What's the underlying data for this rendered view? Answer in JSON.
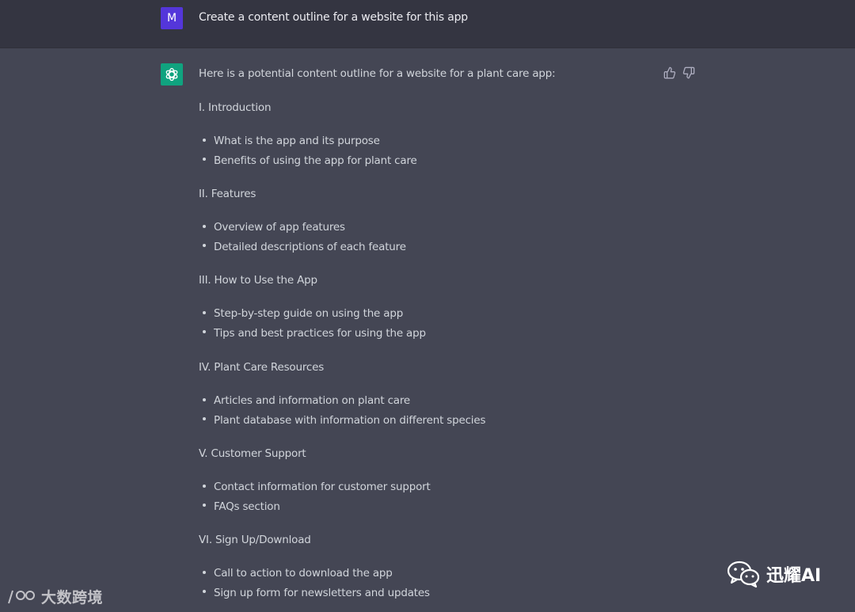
{
  "user_prompt": {
    "avatar_letter": "M",
    "text": "Create a content outline for a website for this app",
    "avatar_color": "#5436da"
  },
  "response": {
    "intro": "Here is a potential content outline for a website for a plant care app:",
    "sections": [
      {
        "heading": "I. Introduction",
        "bullets": [
          "What is the app and its purpose",
          "Benefits of using the app for plant care"
        ]
      },
      {
        "heading": "II. Features",
        "bullets": [
          "Overview of app features",
          "Detailed descriptions of each feature"
        ]
      },
      {
        "heading": "III. How to Use the App",
        "bullets": [
          "Step-by-step guide on using the app",
          "Tips and best practices for using the app"
        ]
      },
      {
        "heading": "IV. Plant Care Resources",
        "bullets": [
          "Articles and information on plant care",
          "Plant database with information on different species"
        ]
      },
      {
        "heading": "V. Customer Support",
        "bullets": [
          "Contact information for customer support",
          "FAQs section"
        ]
      },
      {
        "heading": "VI. Sign Up/Download",
        "bullets": [
          "Call to action to download the app",
          "Sign up form for newsletters and updates"
        ]
      }
    ],
    "assistant_avatar_icon": "openai-logo-icon",
    "assistant_avatar_color": "#10a37f"
  },
  "feedback": {
    "thumbs_up_icon": "thumbs-up-icon",
    "thumbs_down_icon": "thumbs-down-icon"
  },
  "watermarks": {
    "left": "大数跨境",
    "right": "迅耀AI"
  },
  "colors": {
    "user_row_bg": "#343541",
    "assistant_row_bg": "#444654",
    "text": "#d1d5db"
  }
}
